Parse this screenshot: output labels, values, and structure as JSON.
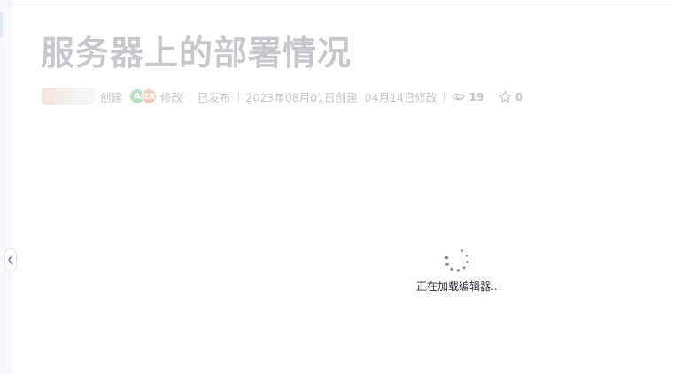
{
  "document": {
    "title": "服务器上的部署情况"
  },
  "meta": {
    "created_action": "创建",
    "modified_action": "修改",
    "avatar_a_letter": "A",
    "avatar_b_text": "沈海",
    "status": "已发布",
    "created_date": "2023年08月01日创建",
    "modified_date": "04月14日修改",
    "views": "19",
    "stars": "0",
    "view_icon": "eye-icon",
    "star_icon": "star-icon"
  },
  "editor": {
    "loading_text": "正在加载编辑器..."
  },
  "sidebar": {
    "toggle_icon": "chevron-left-icon"
  },
  "colors": {
    "title": "#c6c8cc",
    "meta": "#c4c7cc",
    "spinner": "#8a8f99"
  }
}
